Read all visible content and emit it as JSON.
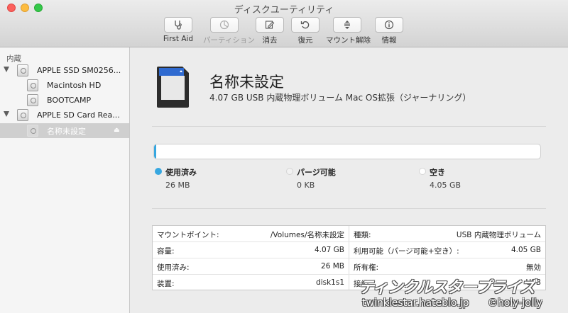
{
  "window": {
    "title": "ディスクユーティリティ"
  },
  "toolbar": [
    {
      "label": "First Aid",
      "icon": "stethoscope-icon",
      "enabled": true
    },
    {
      "label": "パーティション",
      "icon": "partition-pie-icon",
      "enabled": false
    },
    {
      "label": "消去",
      "icon": "erase-pencil-icon",
      "enabled": true
    },
    {
      "label": "復元",
      "icon": "restore-arrow-icon",
      "enabled": true
    },
    {
      "label": "マウント解除",
      "icon": "unmount-icon",
      "enabled": true
    },
    {
      "label": "情報",
      "icon": "info-icon",
      "enabled": true
    }
  ],
  "sidebar": {
    "header": "内蔵",
    "items": [
      {
        "label": "APPLE SSD SM0256...",
        "kind": "disk"
      },
      {
        "label": "Macintosh HD",
        "kind": "volume"
      },
      {
        "label": "BOOTCAMP",
        "kind": "volume"
      },
      {
        "label": "APPLE SD Card Rea...",
        "kind": "disk"
      },
      {
        "label": "名称未設定",
        "kind": "volume",
        "selected": true,
        "eject": "⏏"
      }
    ]
  },
  "volume": {
    "name": "名称未設定",
    "description": "4.07 GB USB 内蔵物理ボリューム Mac OS拡張（ジャーナリング）"
  },
  "usage": {
    "used_fraction": 0.0064,
    "used_color": "#37a7e0",
    "legend": [
      {
        "label": "使用済み",
        "value": "26 MB",
        "color": "#37a7e0"
      },
      {
        "label": "パージ可能",
        "value": "0 KB",
        "color": "#f2f2f2"
      },
      {
        "label": "空き",
        "value": "4.05 GB",
        "color": "#ffffff"
      }
    ]
  },
  "info": {
    "left": [
      {
        "key": "マウントポイント:",
        "value": "/Volumes/名称未設定"
      },
      {
        "key": "容量:",
        "value": "4.07 GB"
      },
      {
        "key": "使用済み:",
        "value": "26 MB"
      },
      {
        "key": "装置:",
        "value": "disk1s1"
      }
    ],
    "right": [
      {
        "key": "種類:",
        "value": "USB 内蔵物理ボリューム"
      },
      {
        "key": "利用可能（パージ可能+空き）:",
        "value": "4.05 GB"
      },
      {
        "key": "所有権:",
        "value": "無効"
      },
      {
        "key": "接続:",
        "value": "USB"
      }
    ]
  },
  "watermark": {
    "brand": "ティンクルスタープライズ",
    "url": "twinklestar.hateblo.jp",
    "handle": "©holy-jolly"
  }
}
